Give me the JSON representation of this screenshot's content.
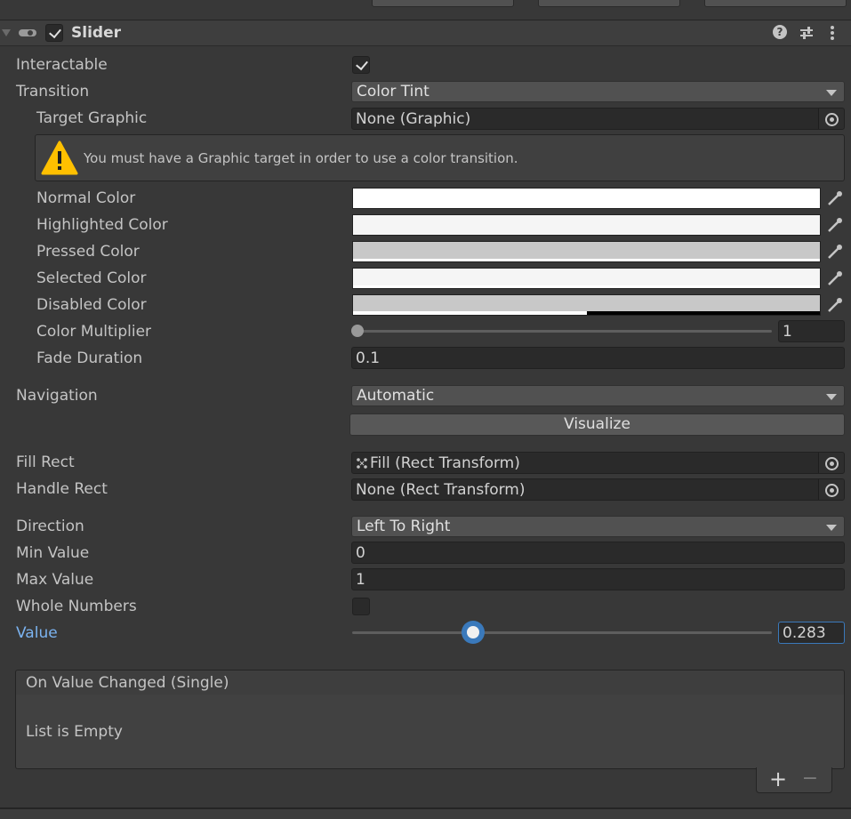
{
  "header": {
    "title": "Slider"
  },
  "fields": {
    "interactable": "Interactable",
    "transition": "Transition",
    "transition_value": "Color Tint",
    "target_graphic": "Target Graphic",
    "target_graphic_value": "None (Graphic)",
    "warning": "You must have a Graphic target in order to use a color transition.",
    "normal_color": "Normal Color",
    "highlighted_color": "Highlighted Color",
    "pressed_color": "Pressed Color",
    "selected_color": "Selected Color",
    "disabled_color": "Disabled Color",
    "color_multiplier": "Color Multiplier",
    "color_multiplier_value": "1",
    "fade_duration": "Fade Duration",
    "fade_duration_value": "0.1",
    "navigation": "Navigation",
    "navigation_value": "Automatic",
    "visualize": "Visualize",
    "fill_rect": "Fill Rect",
    "fill_rect_value": "Fill (Rect Transform)",
    "handle_rect": "Handle Rect",
    "handle_rect_value": "None (Rect Transform)",
    "direction": "Direction",
    "direction_value": "Left To Right",
    "min_value": "Min Value",
    "min_value_value": "0",
    "max_value": "Max Value",
    "max_value_value": "1",
    "whole_numbers": "Whole Numbers",
    "value": "Value",
    "value_value": "0.283"
  },
  "event": {
    "title": "On Value Changed (Single)",
    "empty": "List is Empty",
    "add": "+",
    "remove": "−"
  },
  "colors": {
    "normal": "#ffffff",
    "highlighted": "#f5f5f5",
    "pressed": "#c8c8c8",
    "selected": "#f5f5f5",
    "disabled": "#c8c8c8",
    "value_label": "#7bb3f0"
  },
  "state": {
    "interactable": true,
    "whole_numbers": false,
    "slider_value": 0.283,
    "color_multiplier": 1,
    "component_enabled": true
  }
}
